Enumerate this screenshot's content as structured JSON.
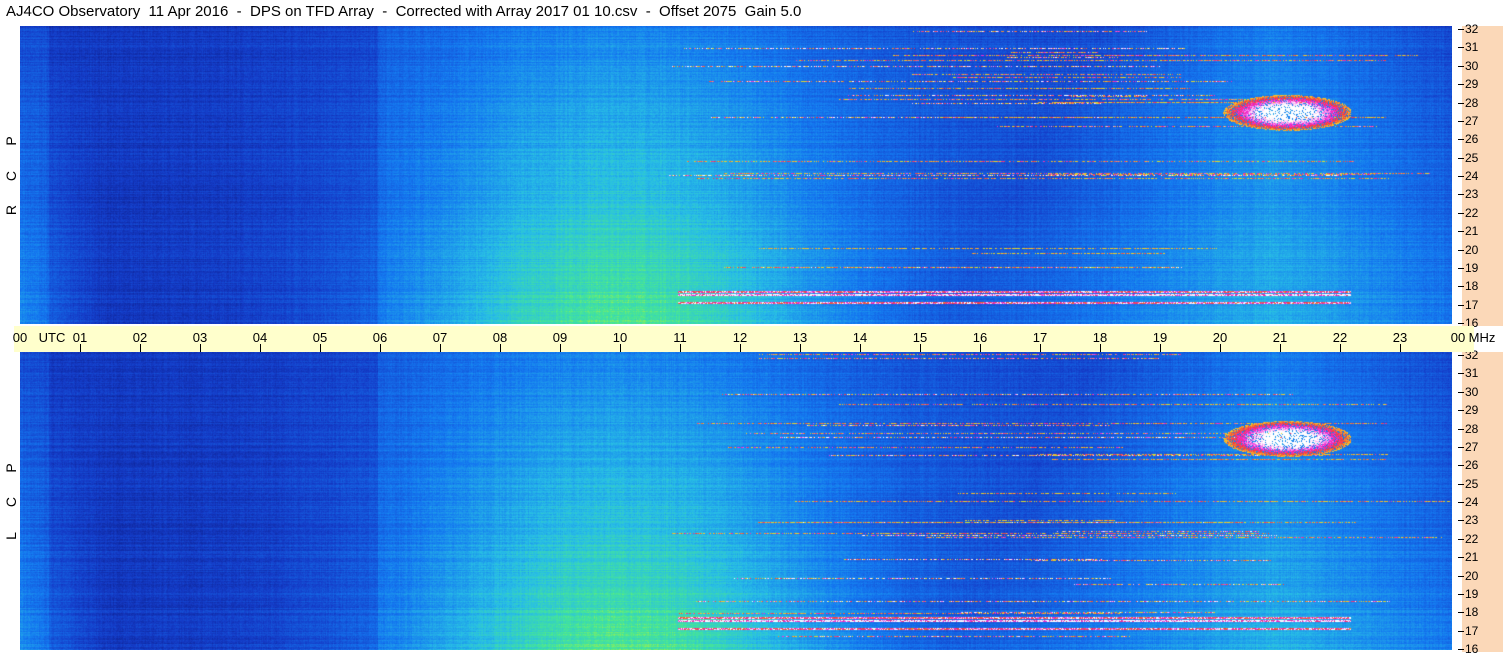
{
  "header": {
    "title": "AJ4CO Observatory  11 Apr 2016  -  DPS on TFD Array  -  Corrected with Array 2017 01 10.csv  -  Offset 2075  Gain 5.0"
  },
  "panels": [
    {
      "id": "rcp",
      "polarization_letters": [
        "P",
        "C",
        "R"
      ]
    },
    {
      "id": "lcp",
      "polarization_letters": [
        "P",
        "C",
        "L"
      ]
    }
  ],
  "time_axis": {
    "start_label": "00",
    "unit_label": "UTC",
    "hour_labels": [
      "01",
      "02",
      "03",
      "04",
      "05",
      "06",
      "07",
      "08",
      "09",
      "10",
      "11",
      "12",
      "13",
      "14",
      "15",
      "16",
      "17",
      "18",
      "19",
      "20",
      "21",
      "22",
      "23"
    ],
    "end_label": "00",
    "end_unit": "MHz"
  },
  "freq_axis": {
    "labels": [
      "32",
      "31",
      "30",
      "29",
      "28",
      "27",
      "26",
      "25",
      "24",
      "23",
      "22",
      "21",
      "20",
      "19",
      "18",
      "17",
      "16"
    ]
  },
  "colors": {
    "axis_background": "#fbd8b8",
    "time_bar_background": "#ffffcc"
  }
}
